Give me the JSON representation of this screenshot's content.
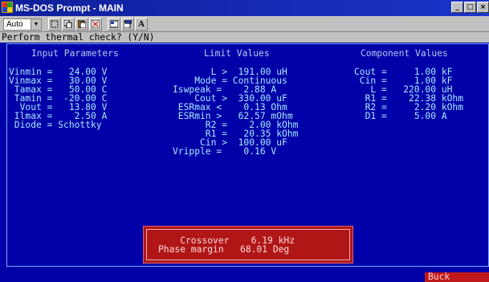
{
  "window": {
    "title": "MS-DOS Prompt - MAIN"
  },
  "toolbar": {
    "font_select": "Auto",
    "font_button_label": "A"
  },
  "console": {
    "prompt": "Perform thermal check? (Y/N)",
    "headers": {
      "input": "Input Parameters",
      "limit": "Limit Values",
      "component": "Component Values"
    },
    "input_lines": [
      "Vinmin =   24.00 V",
      "Vinmax =   30.00 V",
      " Tamax =   50.00 C",
      " Tamin =  -20.00 C",
      "  Vout =   13.80 V",
      " Ilmax =    2.50 A",
      " Diode = Schottky"
    ],
    "limit_lines": [
      "       L >  191.00 uH",
      "    Mode = Continuous",
      "Iswpeak =    2.88 A",
      "    Cout >  330.00 uF",
      " ESRmax <    0.13 Ohm",
      " ESRmin >   62.57 mOhm",
      "      R2 =    2.00 kOhm",
      "      R1 =   20.35 kOhm",
      "     Cin >  100.00 uF",
      "Vripple =    0.16 V"
    ],
    "component_lines": [
      "Cout =     1.00 kF",
      " Cin =     1.00 kF",
      "   L =   220.00 uH",
      "  R1 =    22.38 kOhm",
      "  R2 =     2.20 kOhm",
      "  D1 =     5.00 A"
    ],
    "result_lines": [
      "    Crossover    6.19 kHz",
      "Phase margin   68.01 Deg"
    ],
    "status_mode": "Buck"
  }
}
